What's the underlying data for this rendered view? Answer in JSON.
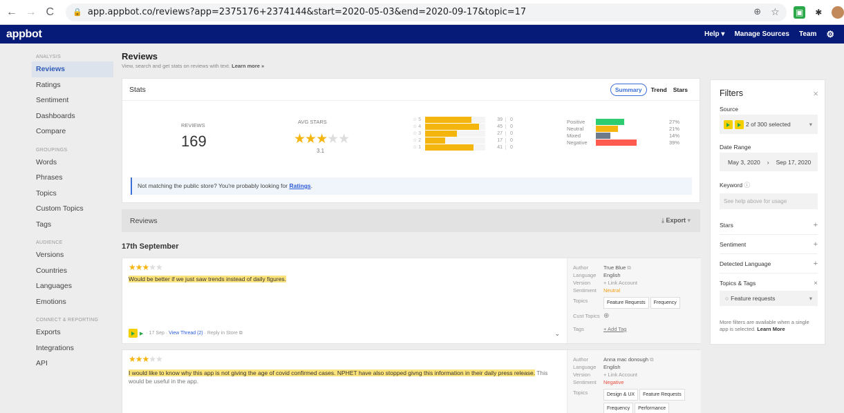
{
  "browser": {
    "url": "app.appbot.co/reviews?app=2375176+2374144&start=2020-05-03&end=2020-09-17&topic=17"
  },
  "brand": {
    "name": "appbot"
  },
  "topnav": {
    "help": "Help",
    "manage_sources": "Manage Sources",
    "team": "Team"
  },
  "sidebar": {
    "analysis": "ANALYSIS",
    "reviews": "Reviews",
    "ratings": "Ratings",
    "sentiment": "Sentiment",
    "dashboards": "Dashboards",
    "compare": "Compare",
    "groupings": "GROUPINGS",
    "words": "Words",
    "phrases": "Phrases",
    "topics": "Topics",
    "custom_topics": "Custom Topics",
    "tags": "Tags",
    "audience": "AUDIENCE",
    "versions": "Versions",
    "countries": "Countries",
    "languages": "Languages",
    "emotions": "Emotions",
    "connect": "CONNECT & REPORTING",
    "exports": "Exports",
    "integrations": "Integrations",
    "api": "API"
  },
  "page": {
    "title": "Reviews",
    "subtitle": "View, search and get stats on reviews with text.",
    "learn_more": "Learn more »"
  },
  "stats": {
    "title": "Stats",
    "tab_summary": "Summary",
    "tab_trend": "Trend",
    "tab_stars": "Stars",
    "reviews_label": "REVIEWS",
    "reviews_count": "169",
    "avg_label": "AVG STARS",
    "avg_value": "3.1",
    "avg_fraction": 0.62,
    "distribution": [
      {
        "star": "5",
        "count": "39",
        "zero": "0",
        "pct": 0.23
      },
      {
        "star": "4",
        "count": "45",
        "zero": "0",
        "pct": 0.27
      },
      {
        "star": "3",
        "count": "27",
        "zero": "0",
        "pct": 0.16
      },
      {
        "star": "2",
        "count": "17",
        "zero": "0",
        "pct": 0.1
      },
      {
        "star": "1",
        "count": "41",
        "zero": "0",
        "pct": 0.24
      }
    ],
    "sentiment": [
      {
        "label": "Positive",
        "pct": "27%",
        "frac": 0.27,
        "color": "#2ecc71"
      },
      {
        "label": "Neutral",
        "pct": "21%",
        "frac": 0.21,
        "color": "#f5b50f"
      },
      {
        "label": "Mixed",
        "pct": "14%",
        "frac": 0.14,
        "color": "#6c7a89"
      },
      {
        "label": "Negative",
        "pct": "39%",
        "frac": 0.39,
        "color": "#ff5a4e"
      }
    ],
    "notice_text": "Not matching the public store? You're probably looking for",
    "notice_link": "Ratings",
    "notice_end": "."
  },
  "reviews_bar": {
    "title": "Reviews",
    "export": "Export"
  },
  "date_heading": "17th September",
  "reviews": [
    {
      "stars": "★★★",
      "stars_empty": "★★",
      "text_hl": "Would be better if we just saw trends instead of daily figures.",
      "text_rest": "",
      "foot_date": "· 17 Sep ·",
      "foot_thread": "View Thread (2)",
      "foot_reply": "· Reply in Store",
      "author_k": "Author",
      "author": "True Blue",
      "lang_k": "Language",
      "lang": "English",
      "ver_k": "Version",
      "ver": "+ Link Account",
      "sent_k": "Sentiment",
      "sent": "Neutral",
      "sent_color": "#f39c12",
      "topics_k": "Topics",
      "topics": [
        "Feature Requests",
        "Frequency"
      ],
      "cust_k": "Cust Topics",
      "tags_k": "Tags",
      "add_tag": "+ Add Tag"
    },
    {
      "stars": "★★★",
      "stars_empty": "★★",
      "text_hl": "I would like to know why this app is not giving the age of covid confirmed cases. NPHET have also stopped givng this information in their daily press release.",
      "text_rest": " This would be useful in the app.",
      "author_k": "Author",
      "author": "Anna mac donough",
      "lang_k": "Language",
      "lang": "English",
      "ver_k": "Version",
      "ver": "+ Link Account",
      "sent_k": "Sentiment",
      "sent": "Negative",
      "sent_color": "#e74c3c",
      "topics_k": "Topics",
      "topics": [
        "Design & UX",
        "Feature Requests",
        "Frequency",
        "Performance"
      ]
    }
  ],
  "filters": {
    "title": "Filters",
    "source_label": "Source",
    "source_value": "2 of 300 selected",
    "date_label": "Date Range",
    "date_from": "May 3, 2020",
    "date_arrow": "›",
    "date_to": "Sep 17, 2020",
    "keyword_label": "Keyword",
    "keyword_placeholder": "See help above for usage",
    "stars": "Stars",
    "sentiment": "Sentiment",
    "detected_language": "Detected Language",
    "topics_tags": "Topics & Tags",
    "topic_value": "Feature requests",
    "note": "More filters are available when a single app is selected.",
    "note_link": "Learn More"
  },
  "colors": {
    "nav": "#061a77",
    "accent": "#3b6fd8",
    "star": "#f5b50f"
  }
}
